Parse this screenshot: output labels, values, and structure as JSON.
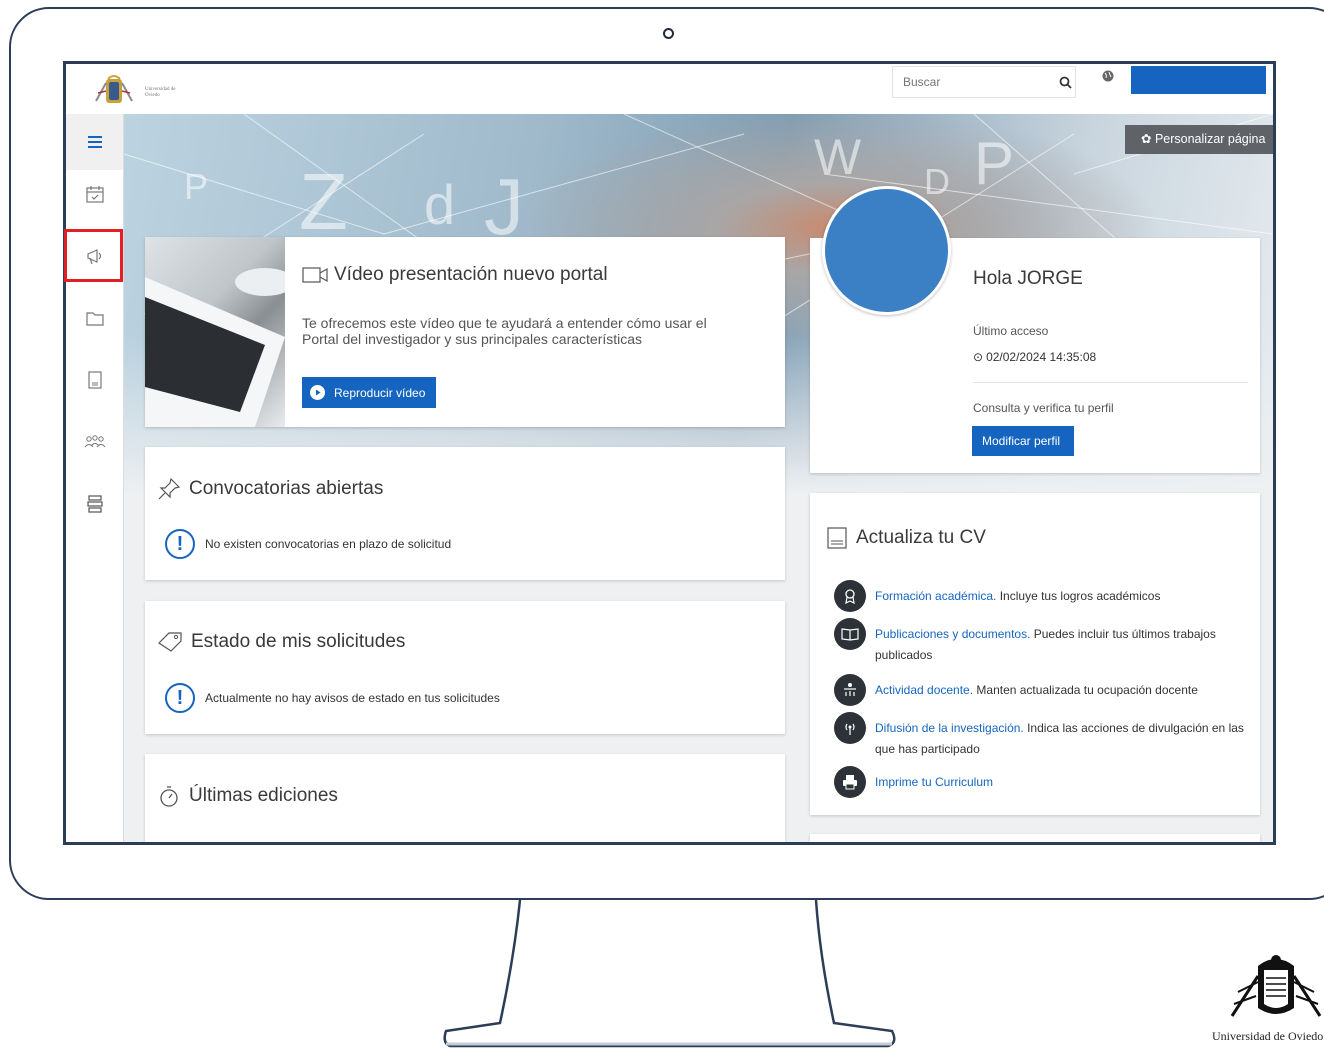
{
  "header": {
    "logo_text_line1": "Universidad de",
    "logo_text_line2": "Oviedo",
    "search_placeholder": "Buscar",
    "search_icon": "search-icon",
    "globe_icon": "globe-icon"
  },
  "sidebar": {
    "items": [
      {
        "name": "menu",
        "icon": "hamburger-icon"
      },
      {
        "name": "calendar",
        "icon": "calendar-check-icon"
      },
      {
        "name": "announcements",
        "icon": "megaphone-icon",
        "highlighted": true
      },
      {
        "name": "folder",
        "icon": "folder-icon"
      },
      {
        "name": "cv",
        "icon": "cv-document-icon"
      },
      {
        "name": "groups",
        "icon": "people-icon"
      },
      {
        "name": "books",
        "icon": "books-icon"
      }
    ]
  },
  "banner": {
    "personalize_label": "Personalizar página"
  },
  "video": {
    "title": "Vídeo presentación nuevo portal",
    "description": "Te ofrecemos este vídeo que te ayudará a entender cómo usar el Portal del investigador y sus principales características",
    "button_label": "Reproducir vídeo"
  },
  "profile": {
    "greeting": "Hola JORGE",
    "last_access_label": "Último acceso",
    "last_access_value": "02/02/2024 14:35:08",
    "verify_text": "Consulta y verifica tu perfil",
    "edit_button": "Modificar perfil"
  },
  "convocatorias": {
    "title": "Convocatorias abiertas",
    "message": "No existen convocatorias en plazo de solicitud"
  },
  "estado": {
    "title": "Estado de mis solicitudes",
    "message": "Actualmente no hay avisos de estado en tus solicitudes"
  },
  "ultimas": {
    "title": "Últimas ediciones"
  },
  "cv": {
    "title": "Actualiza tu CV",
    "items": [
      {
        "link": "Formación académica.",
        "text": " Incluye tus logros académicos",
        "icon": "award-icon"
      },
      {
        "link": "Publicaciones y documentos.",
        "text": " Puedes incluir tus últimos trabajos publicados",
        "icon": "book-icon"
      },
      {
        "link": "Actividad docente.",
        "text": " Manten actualizada tu ocupación docente",
        "icon": "teaching-icon"
      },
      {
        "link": "Difusión de la investigación.",
        "text": " Indica las acciones de divulgación en las que has participado",
        "icon": "broadcast-icon"
      },
      {
        "link": "Imprime tu Curriculum",
        "text": "",
        "icon": "printer-icon"
      }
    ]
  },
  "footer": {
    "university_name": "Universidad de Oviedo"
  },
  "colors": {
    "primary": "#1565c0",
    "highlight": "#e31e24",
    "frame": "#2c3e57"
  }
}
